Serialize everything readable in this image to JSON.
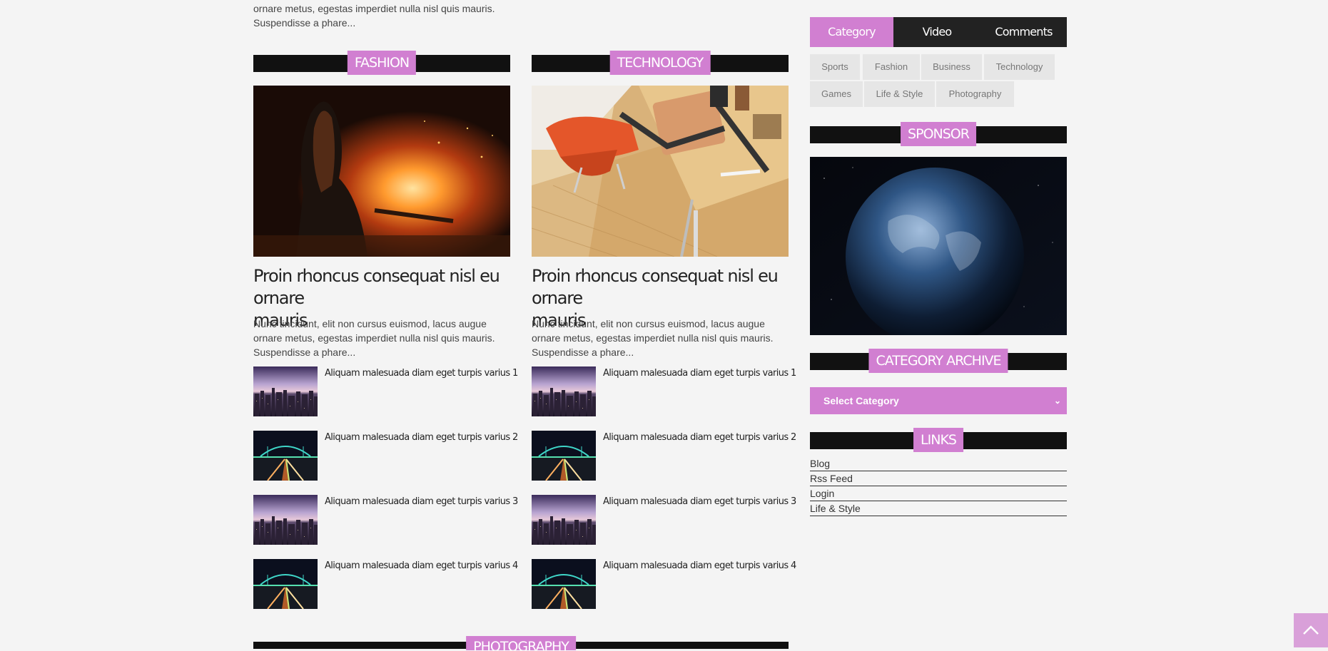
{
  "intro": {
    "line1": "ornare metus, egestas imperdiet nulla nisl quis mauris.",
    "line2": "Suspendisse a phare..."
  },
  "columns": [
    {
      "section": "FASHION",
      "title_line1": "Proin rhoncus consequat nisl eu ornare",
      "title_line2": "mauris",
      "excerpt_line1": "Nunc tincidunt, elit non cursus euismod, lacus augue",
      "excerpt_line2": "ornare metus, egestas imperdiet nulla nisl quis mauris.",
      "excerpt_line3": "Suspendisse a phare...",
      "items": [
        "Aliquam malesuada diam eget turpis varius 1",
        "Aliquam malesuada diam eget turpis varius 2",
        "Aliquam malesuada diam eget turpis varius 3",
        "Aliquam malesuada diam eget turpis varius 4"
      ]
    },
    {
      "section": "TECHNOLOGY",
      "title_line1": "Proin rhoncus consequat nisl eu ornare",
      "title_line2": "mauris",
      "excerpt_line1": "Nunc tincidunt, elit non cursus euismod, lacus augue",
      "excerpt_line2": "ornare metus, egestas imperdiet nulla nisl quis mauris.",
      "excerpt_line3": "Suspendisse a phare...",
      "items": [
        "Aliquam malesuada diam eget turpis varius 1",
        "Aliquam malesuada diam eget turpis varius 2",
        "Aliquam malesuada diam eget turpis varius 3",
        "Aliquam malesuada diam eget turpis varius 4"
      ]
    }
  ],
  "bottom_section": "PHOTOGRAPHY",
  "sidebar": {
    "tabs": [
      "Category",
      "Video",
      "Comments"
    ],
    "categories": [
      "Sports",
      "Fashion",
      "Business",
      "Technology",
      "Games",
      "Life & Style",
      "Photography"
    ],
    "sponsor_heading": "SPONSOR",
    "archive_heading": "CATEGORY ARCHIVE",
    "select_value": "Select Category",
    "links_heading": "LINKS",
    "links": [
      "Blog",
      "Rss Feed",
      "Login",
      "Life & Style"
    ]
  },
  "icons": {
    "back_to_top": "chevron-up-icon",
    "select_arrow": "chevron-down-icon"
  },
  "colors": {
    "accent": "#d17fd1",
    "bar": "#111111",
    "tabs_bg": "#222222",
    "chip_bg": "#e6e6e6",
    "page_bg": "#f4f4f4"
  }
}
